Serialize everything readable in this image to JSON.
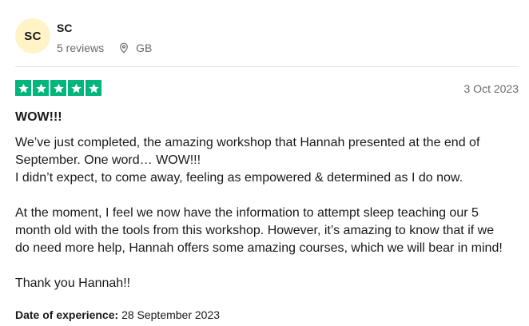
{
  "reviewer": {
    "initials": "SC",
    "name": "SC",
    "reviews_count": "5 reviews",
    "location": "GB",
    "avatar_color": "#fff3c7"
  },
  "review": {
    "rating": 5,
    "rating_color": "#00b67a",
    "date": "3 Oct 2023",
    "title": "WOW!!!",
    "body_lines": [
      "We’ve just completed, the amazing workshop that Hannah presented at the end of",
      "September. One word… WOW!!!",
      "I didn’t expect, to come away, feeling as empowered & determined as I do now.",
      "At the moment, I feel we now have the information to attempt sleep teaching our 5",
      "month old with the tools from this workshop. However, it’s amazing to know that if we",
      "do need more help, Hannah offers some amazing courses, which we will bear in mind!",
      "Thank you Hannah!!"
    ],
    "experience_label": "Date of experience:",
    "experience_date": "28 September 2023"
  }
}
